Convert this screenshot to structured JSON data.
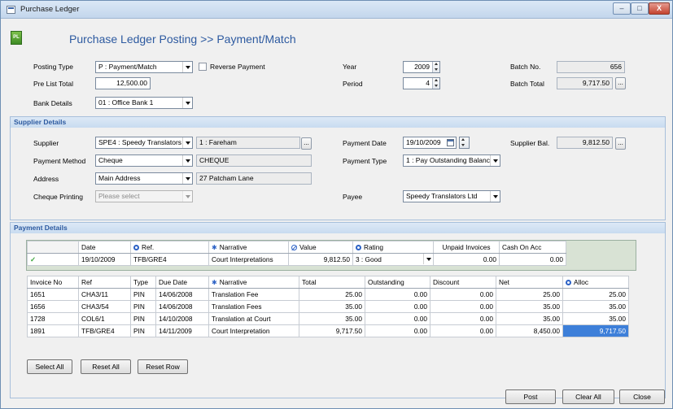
{
  "window": {
    "title": "Purchase Ledger",
    "min": "–",
    "max": "□",
    "close": "X"
  },
  "header": {
    "logo": "PL",
    "title": "Purchase Ledger Posting >> Payment/Match"
  },
  "posting": {
    "posting_type_label": "Posting Type",
    "posting_type_value": "P : Payment/Match",
    "reverse_label": "Reverse Payment",
    "pre_list_label": "Pre List Total",
    "pre_list_value": "12,500.00",
    "bank_label": "Bank Details",
    "bank_value": "01 : Office Bank 1",
    "year_label": "Year",
    "year_value": "2009",
    "period_label": "Period",
    "period_value": "4",
    "batch_no_label": "Batch No.",
    "batch_no_value": "656",
    "batch_total_label": "Batch Total",
    "batch_total_value": "9,717.50",
    "ellipsis": "..."
  },
  "supplier": {
    "section_title": "Supplier Details",
    "supplier_label": "Supplier",
    "supplier_value": "SPE4 : Speedy Translators",
    "location_value": "1 : Fareham",
    "method_label": "Payment Method",
    "method_value": "Cheque",
    "method_text": "CHEQUE",
    "address_label": "Address",
    "address_value": "Main Address",
    "address_text": "27 Patcham Lane",
    "cheque_label": "Cheque Printing",
    "cheque_value": "Please select",
    "date_label": "Payment Date",
    "date_value": "19/10/2009",
    "ptype_label": "Payment Type",
    "ptype_value": "1 : Pay Outstanding Balanc",
    "payee_label": "Payee",
    "payee_value": "Speedy Translators Ltd",
    "bal_label": "Supplier Bal.",
    "bal_value": "9,812.50"
  },
  "payment": {
    "section_title": "Payment Details",
    "headers": [
      "Date",
      "Ref.",
      "Narrative",
      "Value",
      "Rating",
      "Unpaid Invoices",
      "Cash On Acc"
    ],
    "row": [
      "19/10/2009",
      "TFB/GRE4",
      "Court Interpretations",
      "9,812.50",
      "3 : Good",
      "0.00",
      "0.00"
    ],
    "tick": "✓"
  },
  "invoices": {
    "headers": [
      "Invoice No",
      "Ref",
      "Type",
      "Due Date",
      "Narrative",
      "Total",
      "Outstanding",
      "Discount",
      "Net",
      "Alloc"
    ],
    "rows": [
      [
        "1651",
        "CHA3/11",
        "PIN",
        "14/06/2008",
        "Translation Fee",
        "25.00",
        "0.00",
        "0.00",
        "25.00",
        "25.00"
      ],
      [
        "1656",
        "CHA3/54",
        "PIN",
        "14/06/2008",
        "Translation Fees",
        "35.00",
        "0.00",
        "0.00",
        "35.00",
        "35.00"
      ],
      [
        "1728",
        "COL6/1",
        "PIN",
        "14/10/2008",
        "Translation at Court",
        "35.00",
        "0.00",
        "0.00",
        "35.00",
        "35.00"
      ],
      [
        "1891",
        "TFB/GRE4",
        "PIN",
        "14/11/2009",
        "Court Interpretation",
        "9,717.50",
        "0.00",
        "0.00",
        "8,450.00",
        "9,717.50"
      ]
    ]
  },
  "buttons": {
    "select_all": "Select All",
    "reset_all": "Reset All",
    "reset_row": "Reset Row",
    "post": "Post",
    "clear_all": "Clear All",
    "close": "Close"
  }
}
